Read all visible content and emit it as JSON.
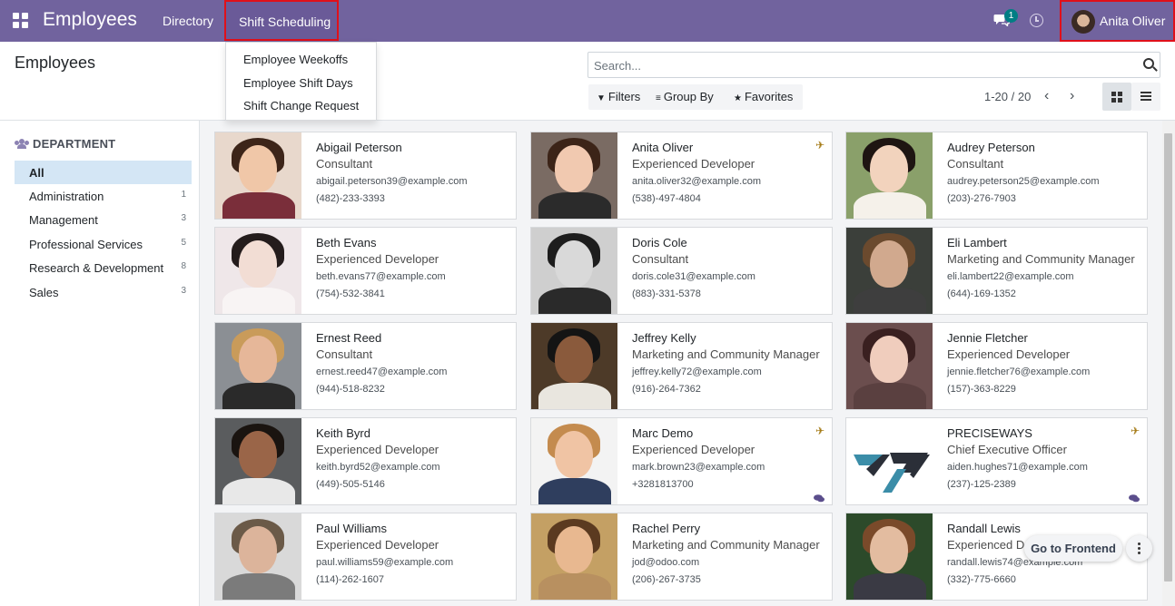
{
  "navbar": {
    "app_title": "Employees",
    "menu_directory": "Directory",
    "menu_shift": "Shift Scheduling",
    "chat_badge": "1",
    "user_name": "Anita Oliver",
    "bg_color": "#71639e"
  },
  "dropdown": {
    "items": [
      "Employee Weekoffs",
      "Employee Shift Days",
      "Shift Change Request"
    ]
  },
  "control": {
    "page_title": "Employees",
    "search_placeholder": "Search...",
    "filters_label": "Filters",
    "groupby_label": "Group By",
    "favorites_label": "Favorites",
    "pager": "1-20 / 20",
    "active_view": "kanban"
  },
  "sidebar": {
    "heading": "DEPARTMENT",
    "items": [
      {
        "label": "All",
        "count": ""
      },
      {
        "label": "Administration",
        "count": "1"
      },
      {
        "label": "Management",
        "count": "3"
      },
      {
        "label": "Professional Services",
        "count": "5"
      },
      {
        "label": "Research & Development",
        "count": "8"
      },
      {
        "label": "Sales",
        "count": "3"
      }
    ]
  },
  "employees": [
    {
      "name": "Abigail Peterson",
      "job": "Consultant",
      "email": "abigail.peterson39@example.com",
      "phone": "(482)-233-3393",
      "away": false,
      "chat": false
    },
    {
      "name": "Anita Oliver",
      "job": "Experienced Developer",
      "email": "anita.oliver32@example.com",
      "phone": "(538)-497-4804",
      "away": true,
      "chat": false
    },
    {
      "name": "Audrey Peterson",
      "job": "Consultant",
      "email": "audrey.peterson25@example.com",
      "phone": "(203)-276-7903",
      "away": false,
      "chat": false
    },
    {
      "name": "Beth Evans",
      "job": "Experienced Developer",
      "email": "beth.evans77@example.com",
      "phone": "(754)-532-3841",
      "away": false,
      "chat": false
    },
    {
      "name": "Doris Cole",
      "job": "Consultant",
      "email": "doris.cole31@example.com",
      "phone": "(883)-331-5378",
      "away": false,
      "chat": false
    },
    {
      "name": "Eli Lambert",
      "job": "Marketing and Community Manager",
      "email": "eli.lambert22@example.com",
      "phone": "(644)-169-1352",
      "away": false,
      "chat": false
    },
    {
      "name": "Ernest Reed",
      "job": "Consultant",
      "email": "ernest.reed47@example.com",
      "phone": "(944)-518-8232",
      "away": false,
      "chat": false
    },
    {
      "name": "Jeffrey Kelly",
      "job": "Marketing and Community Manager",
      "email": "jeffrey.kelly72@example.com",
      "phone": "(916)-264-7362",
      "away": false,
      "chat": false
    },
    {
      "name": "Jennie Fletcher",
      "job": "Experienced Developer",
      "email": "jennie.fletcher76@example.com",
      "phone": "(157)-363-8229",
      "away": false,
      "chat": false
    },
    {
      "name": "Keith Byrd",
      "job": "Experienced Developer",
      "email": "keith.byrd52@example.com",
      "phone": "(449)-505-5146",
      "away": false,
      "chat": false
    },
    {
      "name": "Marc Demo",
      "job": "Experienced Developer",
      "email": "mark.brown23@example.com",
      "phone": "+3281813700",
      "away": true,
      "chat": true
    },
    {
      "name": "PRECISEWAYS",
      "job": "Chief Executive Officer",
      "email": "aiden.hughes71@example.com",
      "phone": "(237)-125-2389",
      "away": true,
      "chat": true
    },
    {
      "name": "Paul Williams",
      "job": "Experienced Developer",
      "email": "paul.williams59@example.com",
      "phone": "(114)-262-1607",
      "away": false,
      "chat": false
    },
    {
      "name": "Rachel Perry",
      "job": "Marketing and Community Manager",
      "email": "jod@odoo.com",
      "phone": "(206)-267-3735",
      "away": false,
      "chat": false
    },
    {
      "name": "Randall Lewis",
      "job": "Experienced Developer",
      "email": "randall.lewis74@example.com",
      "phone": "(332)-775-6660",
      "away": false,
      "chat": false
    }
  ],
  "floating": {
    "goto_label": "Go to Frontend"
  }
}
